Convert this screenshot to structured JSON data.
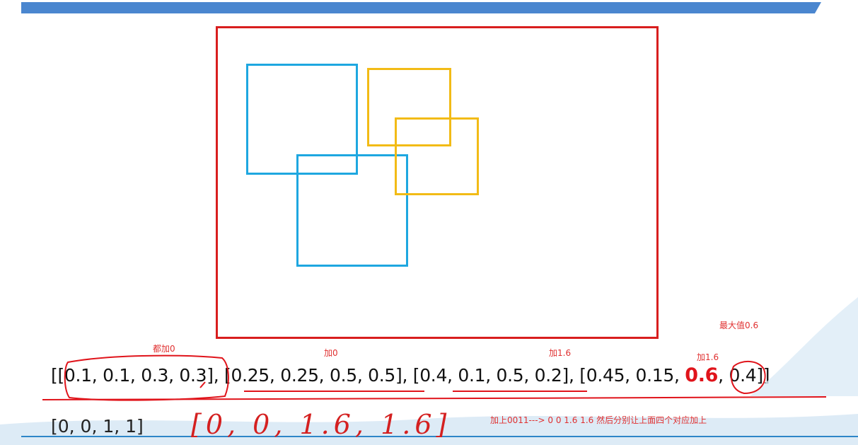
{
  "colors": {
    "header_bar": "#4a86cf",
    "frame": "#d81e1e",
    "blue_box": "#1ea7e0",
    "yellow_box": "#f2bb16",
    "annotation": "#e03030"
  },
  "labels": {
    "max_value": "最大值0.6",
    "group1_note": "都加0",
    "group2_note": "加0",
    "group3_note": "加1.6",
    "group4_note": "加1.6",
    "mask_note": "加上0011--->   0 0 1.6 1.6    然后分别让上面四个对应加上"
  },
  "arrays": {
    "open": "[[",
    "g1": "0.1, 0.1, 0.3, 0.3",
    "sep1": "],  [",
    "g2": "0.25, 0.25, 0.5, 0.5",
    "sep2": "],  [",
    "g3": "0.4, 0.1, 0.5, 0.2",
    "sep3": "],  [",
    "g4_pre": "0.45, 0.15, ",
    "g4_max": "0.6",
    "g4_post": ", 0.4",
    "close": "]]"
  },
  "mask_row": "[0,  0,  1,  1]",
  "handwritten": "[0, 0, 1.6, 1.6]"
}
